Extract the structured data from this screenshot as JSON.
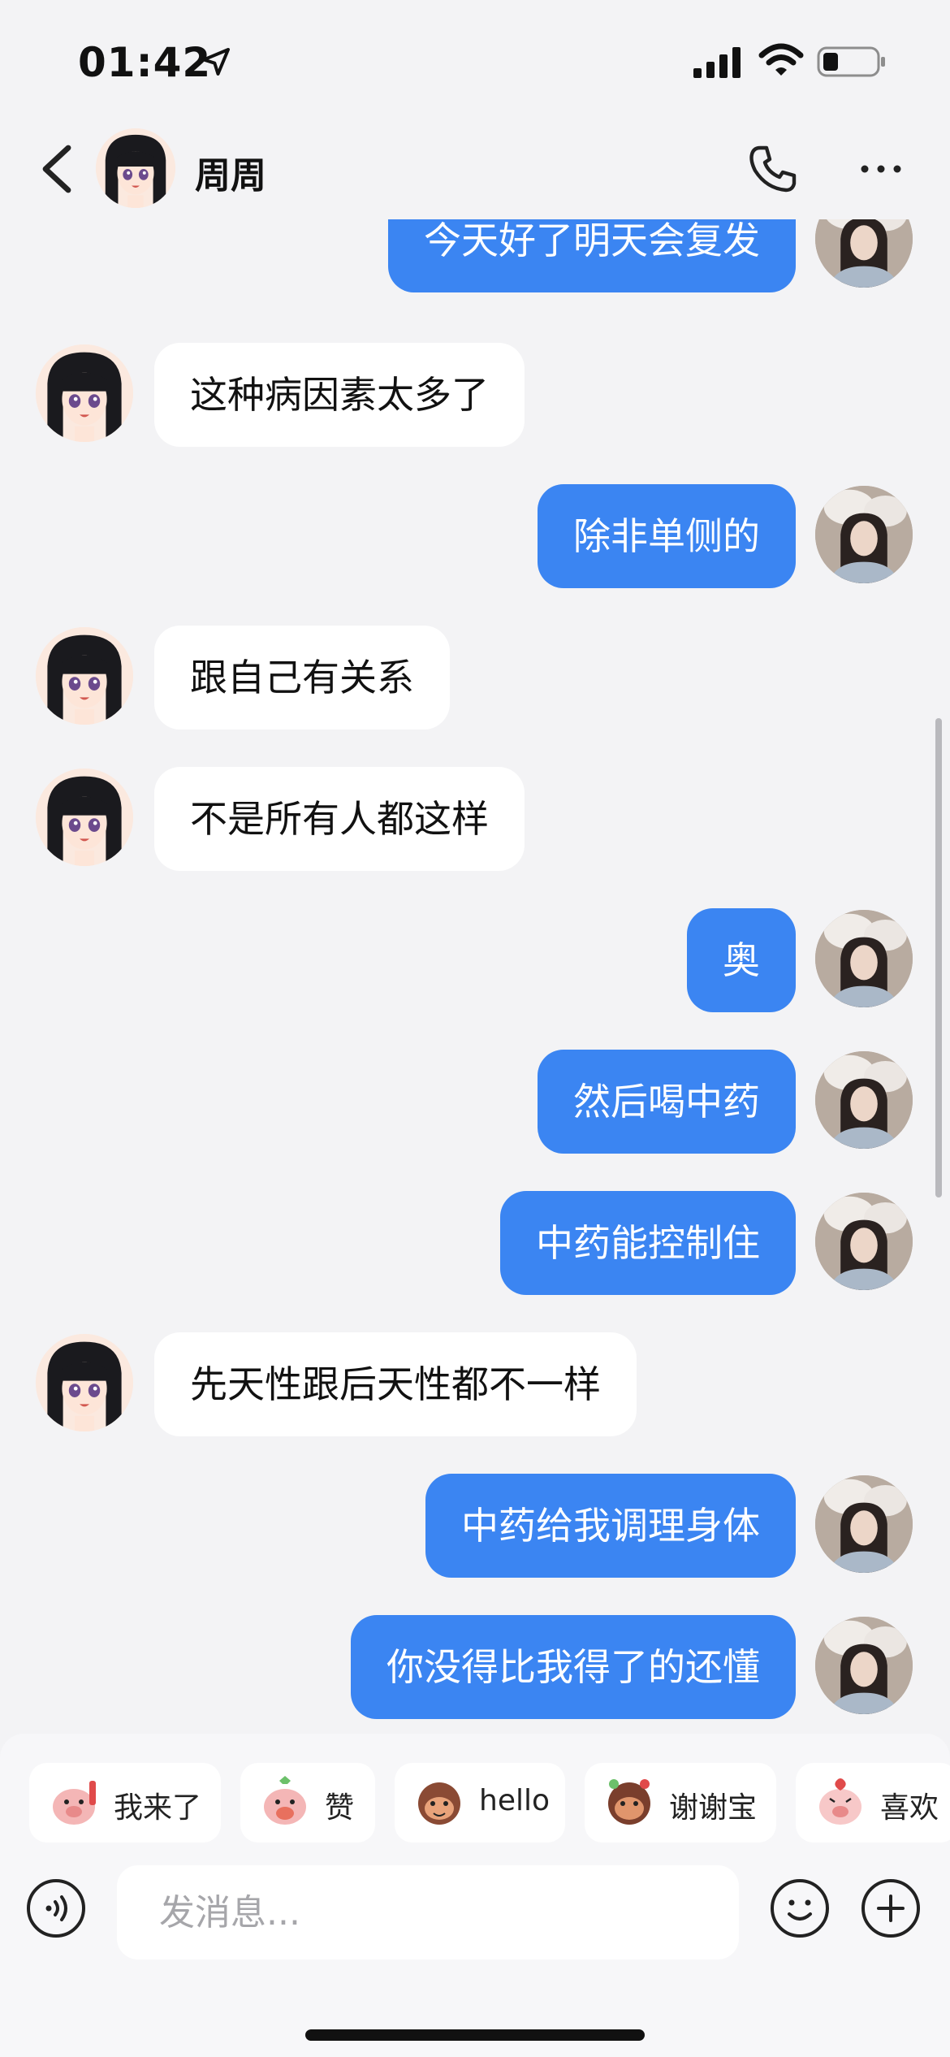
{
  "status_bar": {
    "time": "01:42",
    "icons": [
      "location-arrow-icon",
      "signal-icon",
      "wifi-icon",
      "battery-icon"
    ]
  },
  "header": {
    "title": "周周",
    "icons": [
      "back-icon",
      "phone-icon",
      "more-icon"
    ]
  },
  "messages": [
    {
      "side": "right",
      "text": "今天好了明天会复发"
    },
    {
      "side": "left",
      "text": "这种病因素太多了"
    },
    {
      "side": "right",
      "text": "除非单侧的"
    },
    {
      "side": "left",
      "text": "跟自己有关系"
    },
    {
      "side": "left",
      "text": "不是所有人都这样"
    },
    {
      "side": "right",
      "text": "奥"
    },
    {
      "side": "right",
      "text": "然后喝中药"
    },
    {
      "side": "right",
      "text": "中药能控制住"
    },
    {
      "side": "left",
      "text": "先天性跟后天性都不一样"
    },
    {
      "side": "right",
      "text": "中药给我调理身体"
    },
    {
      "side": "right",
      "text": "你没得比我得了的还懂"
    }
  ],
  "quick_stickers": [
    {
      "label": "我来了",
      "icon": "sticker-icon"
    },
    {
      "label": "赞",
      "icon": "sticker-icon"
    },
    {
      "label": "hello",
      "icon": "sticker-icon"
    },
    {
      "label": "谢谢宝",
      "icon": "sticker-icon"
    },
    {
      "label": "喜欢",
      "icon": "sticker-icon"
    }
  ],
  "input": {
    "placeholder": "发消息...",
    "value": ""
  },
  "colors": {
    "background": "#f3f3f5",
    "outgoing_bubble": "#3b85f2",
    "incoming_bubble": "#ffffff"
  }
}
